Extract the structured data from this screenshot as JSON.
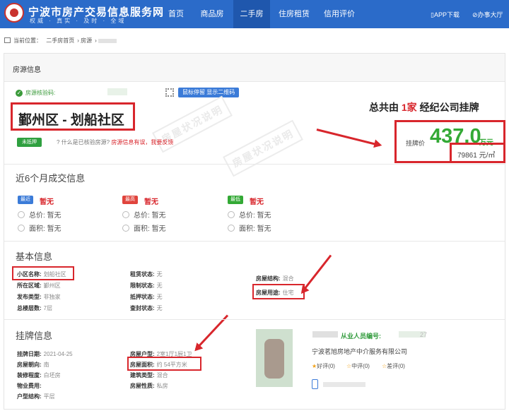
{
  "header": {
    "site_title": "宁波市房产交易信息服务网",
    "site_slogan": "权威 · 真实 · 及时 · 全域",
    "nav": [
      {
        "label": "首页"
      },
      {
        "label": "商品房"
      },
      {
        "label": "二手房"
      },
      {
        "label": "住房租赁"
      },
      {
        "label": "信用评价"
      }
    ],
    "app_download": "APP下载",
    "service_hall": "办事大厅",
    "brand_color": "#2b6bc9"
  },
  "breadcrumb": {
    "current_label": "当前位置：",
    "items": [
      "二手房首页",
      "房源"
    ]
  },
  "listing": {
    "section_title": "房源信息",
    "verify_label": "房源核验码:",
    "qr_hint": "鼠标停留 显示二维码",
    "title": "鄞州区 - 划船社区",
    "status_badge": "未抵押",
    "verify_question": "什么是已核验房源?",
    "report_text": "房源信息有误，我要反馈",
    "watermark": "房屋状况说明",
    "agency_prefix": "总共由",
    "agency_count": "1家",
    "agency_suffix": "经纪公司挂牌",
    "price_label": "挂牌价",
    "price_value": "437.0",
    "price_unit": "万元",
    "unit_price": "79861 元/㎡"
  },
  "deals": {
    "section_title": "近6个月成交信息",
    "columns": [
      {
        "tag": "最近",
        "tag_color": "#3b7bd8",
        "status": "暂无",
        "total_label": "总价:",
        "total_value": "暂无",
        "area_label": "面积:",
        "area_value": "暂无"
      },
      {
        "tag": "最高",
        "tag_color": "#e0443d",
        "status": "暂无",
        "total_label": "总价:",
        "total_value": "暂无",
        "area_label": "面积:",
        "area_value": "暂无"
      },
      {
        "tag": "最低",
        "tag_color": "#33a935",
        "status": "暂无",
        "total_label": "总价:",
        "total_value": "暂无",
        "area_label": "面积:",
        "area_value": "暂无"
      }
    ]
  },
  "basic_info": {
    "section_title": "基本信息",
    "col1": [
      {
        "k": "小区名称:",
        "v": "划船社区"
      },
      {
        "k": "所在区域:",
        "v": "鄞州区"
      },
      {
        "k": "发布类型:",
        "v": "非独家"
      },
      {
        "k": "总楼层数:",
        "v": "7层"
      }
    ],
    "col2": [
      {
        "k": "租赁状态:",
        "v": "无"
      },
      {
        "k": "限制状态:",
        "v": "无"
      },
      {
        "k": "抵押状态:",
        "v": "无"
      },
      {
        "k": "查封状态:",
        "v": "无"
      }
    ],
    "col3": [
      {
        "k": "房屋结构:",
        "v": "混合"
      },
      {
        "k": "房屋用途:",
        "v": "住宅"
      }
    ]
  },
  "listing_info": {
    "section_title": "挂牌信息",
    "col1": [
      {
        "k": "挂牌日期:",
        "v": "2021-04-25"
      },
      {
        "k": "房屋朝向:",
        "v": "南"
      },
      {
        "k": "装修程度:",
        "v": "白坯房"
      },
      {
        "k": "物业费用:",
        "v": ""
      },
      {
        "k": "户型结构:",
        "v": "平层"
      }
    ],
    "col2": [
      {
        "k": "房屋户型:",
        "v": "2室1厅1厨1卫"
      },
      {
        "k": "房屋面积:",
        "v": "约 54平方米"
      },
      {
        "k": "建筑类型:",
        "v": "混合"
      },
      {
        "k": "房屋性质:",
        "v": "私房"
      }
    ]
  },
  "agent": {
    "id_label": "从业人员编号:",
    "id_suffix": "27",
    "company": "宁波茗旭房地产中介服务有限公司",
    "ratings": [
      {
        "label": "好评(0)"
      },
      {
        "label": "中评(0)"
      },
      {
        "label": "差评(0)"
      }
    ]
  }
}
